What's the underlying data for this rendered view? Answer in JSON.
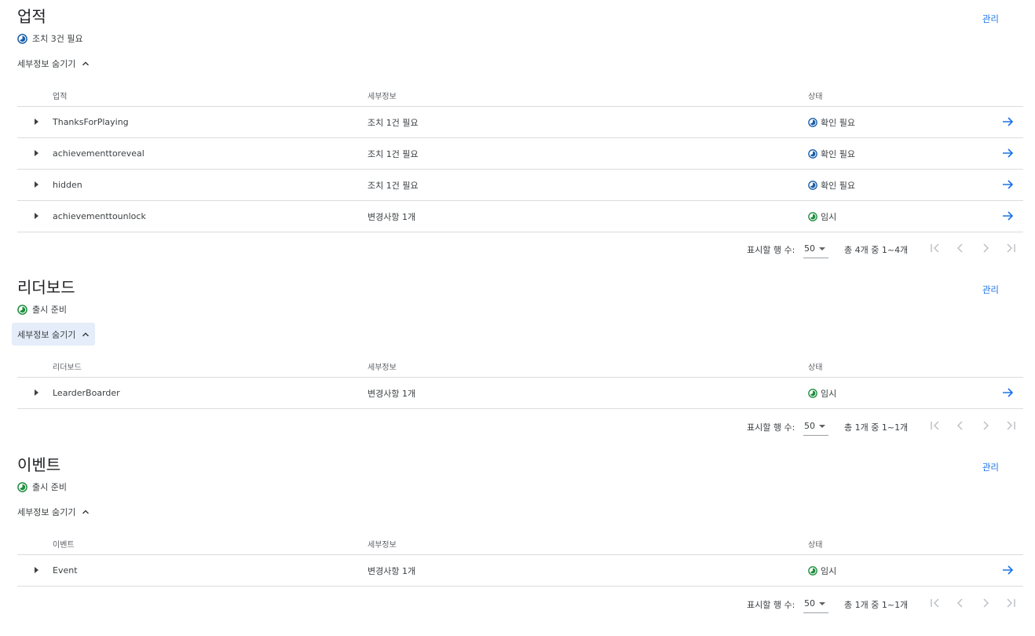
{
  "sections": [
    {
      "title": "업적",
      "manage_label": "관리",
      "status_text": "조치 3건 필요",
      "status_color": "#1a5fa8",
      "toggle_label": "세부정보 숨기기",
      "columns": [
        "업적",
        "세부정보",
        "상태"
      ],
      "rows": [
        {
          "name": "ThanksForPlaying",
          "detail": "조치 1건 필요",
          "status": "확인 필요",
          "status_color": "#1a5fa8"
        },
        {
          "name": "achievementtoreveal",
          "detail": "조치 1건 필요",
          "status": "확인 필요",
          "status_color": "#1a5fa8"
        },
        {
          "name": "hidden",
          "detail": "조치 1건 필요",
          "status": "확인 필요",
          "status_color": "#1a5fa8"
        },
        {
          "name": "achievementtounlock",
          "detail": "변경사항 1개",
          "status": "임시",
          "status_color": "#1e8e3e"
        }
      ],
      "pager": {
        "rows_label": "표시할 행 수:",
        "rows_value": "50",
        "range": "총 4개 중 1~4개"
      }
    },
    {
      "title": "리더보드",
      "manage_label": "관리",
      "status_text": "출시 준비",
      "status_color": "#1e8e3e",
      "toggle_label": "세부정보 숨기기",
      "columns": [
        "리더보드",
        "세부정보",
        "상태"
      ],
      "rows": [
        {
          "name": "LearderBoarder",
          "detail": "변경사항 1개",
          "status": "임시",
          "status_color": "#1e8e3e"
        }
      ],
      "pager": {
        "rows_label": "표시할 행 수:",
        "rows_value": "50",
        "range": "총 1개 중 1~1개"
      }
    },
    {
      "title": "이벤트",
      "manage_label": "관리",
      "status_text": "출시 준비",
      "status_color": "#1e8e3e",
      "toggle_label": "세부정보 숨기기",
      "columns": [
        "이벤트",
        "세부정보",
        "상태"
      ],
      "rows": [
        {
          "name": "Event",
          "detail": "변경사항 1개",
          "status": "임시",
          "status_color": "#1e8e3e"
        }
      ],
      "pager": {
        "rows_label": "표시할 행 수:",
        "rows_value": "50",
        "range": "총 1개 중 1~1개"
      }
    }
  ],
  "icons": {
    "status": "status-pie-icon",
    "expand": "caret-right-icon",
    "open": "arrow-right-icon",
    "toggle": "chevron-up-icon",
    "dropdown": "dropdown-triangle-icon",
    "first": "first-page-icon",
    "prev": "previous-page-icon",
    "next": "next-page-icon",
    "last": "last-page-icon"
  },
  "colors": {
    "accent": "#1a73e8",
    "toggle_active_bg": "#e4edf9",
    "divider": "#dadce0"
  }
}
